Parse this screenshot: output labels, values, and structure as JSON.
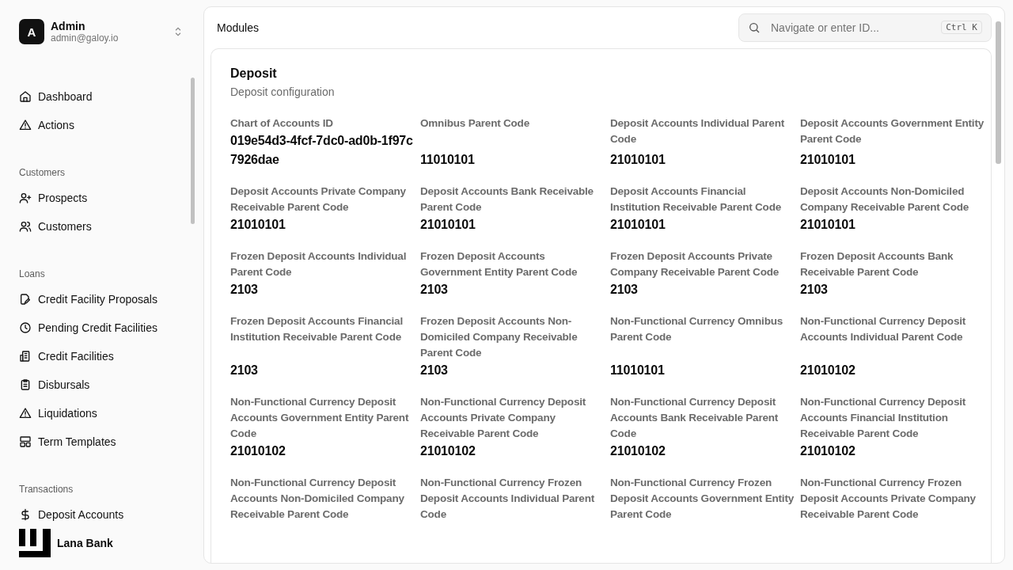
{
  "user": {
    "initial": "A",
    "name": "Admin",
    "email": "admin@galoy.io"
  },
  "nav": [
    {
      "kind": "item",
      "label": "Dashboard"
    },
    {
      "kind": "item",
      "label": "Actions"
    },
    {
      "kind": "section",
      "label": "Customers"
    },
    {
      "kind": "item",
      "label": "Prospects"
    },
    {
      "kind": "item",
      "label": "Customers"
    },
    {
      "kind": "section",
      "label": "Loans"
    },
    {
      "kind": "item",
      "label": "Credit Facility Proposals"
    },
    {
      "kind": "item",
      "label": "Pending Credit Facilities"
    },
    {
      "kind": "item",
      "label": "Credit Facilities"
    },
    {
      "kind": "item",
      "label": "Disbursals"
    },
    {
      "kind": "item",
      "label": "Liquidations"
    },
    {
      "kind": "item",
      "label": "Term Templates"
    },
    {
      "kind": "section",
      "label": "Transactions"
    },
    {
      "kind": "item",
      "label": "Deposit Accounts"
    }
  ],
  "brand": "Lana Bank",
  "page_title": "Modules",
  "search": {
    "placeholder": "Navigate or enter ID...",
    "shortcut": "Ctrl K"
  },
  "card": {
    "title": "Deposit",
    "subtitle": "Deposit configuration",
    "fields": [
      {
        "label": "Chart of Accounts ID",
        "value": "019e54d3-4fcf-7dc0-ad0b-1f97c7926dae"
      },
      {
        "label": "Omnibus Parent Code",
        "value": "11010101"
      },
      {
        "label": "Deposit Accounts Individual Parent Code",
        "value": "21010101"
      },
      {
        "label": "Deposit Accounts Government Entity Parent Code",
        "value": "21010101"
      },
      {
        "label": "Deposit Accounts Private Company Receivable Parent Code",
        "value": "21010101"
      },
      {
        "label": "Deposit Accounts Bank Receivable Parent Code",
        "value": "21010101"
      },
      {
        "label": "Deposit Accounts Financial Institution Receivable Parent Code",
        "value": "21010101"
      },
      {
        "label": "Deposit Accounts Non-Domiciled Company Receivable Parent Code",
        "value": "21010101"
      },
      {
        "label": "Frozen Deposit Accounts Individual Parent Code",
        "value": "2103"
      },
      {
        "label": "Frozen Deposit Accounts Government Entity Parent Code",
        "value": "2103"
      },
      {
        "label": "Frozen Deposit Accounts Private Company Receivable Parent Code",
        "value": "2103"
      },
      {
        "label": "Frozen Deposit Accounts Bank Receivable Parent Code",
        "value": "2103"
      },
      {
        "label": "Frozen Deposit Accounts Financial Institution Receivable Parent Code",
        "value": "2103"
      },
      {
        "label": "Frozen Deposit Accounts Non-Domiciled Company Receivable Parent Code",
        "value": "2103"
      },
      {
        "label": "Non-Functional Currency Omnibus Parent Code",
        "value": "11010101"
      },
      {
        "label": "Non-Functional Currency Deposit Accounts Individual Parent Code",
        "value": "21010102"
      },
      {
        "label": "Non-Functional Currency Deposit Accounts Government Entity Parent Code",
        "value": "21010102"
      },
      {
        "label": "Non-Functional Currency Deposit Accounts Private Company Receivable Parent Code",
        "value": "21010102"
      },
      {
        "label": "Non-Functional Currency Deposit Accounts Bank Receivable Parent Code",
        "value": "21010102"
      },
      {
        "label": "Non-Functional Currency Deposit Accounts Financial Institution Receivable Parent Code",
        "value": "21010102"
      },
      {
        "label": "Non-Functional Currency Deposit Accounts Non-Domiciled Company Receivable Parent Code"
      },
      {
        "label": "Non-Functional Currency Frozen Deposit Accounts Individual Parent Code"
      },
      {
        "label": "Non-Functional Currency Frozen Deposit Accounts Government Entity Parent Code"
      },
      {
        "label": "Non-Functional Currency Frozen Deposit Accounts Private Company Receivable Parent Code"
      }
    ]
  }
}
